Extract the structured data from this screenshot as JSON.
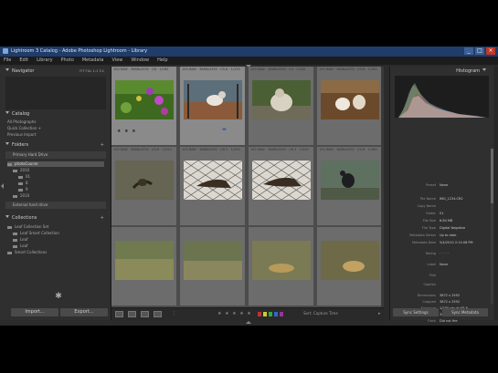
{
  "window": {
    "title": "Lightroom 3 Catalog - Adobe Photoshop Lightroom - Library",
    "controls": [
      "_",
      "□",
      "×"
    ]
  },
  "menu": [
    "File",
    "Edit",
    "Library",
    "Photo",
    "Metadata",
    "View",
    "Window",
    "Help"
  ],
  "left_panel": {
    "navigator": {
      "title": "Navigator",
      "modes": "FIT  FILL  1:1  3:1"
    },
    "catalog": {
      "title": "Catalog",
      "items": [
        {
          "label": "All Photographs",
          "count": ""
        },
        {
          "label": "Quick Collection +",
          "count": ""
        },
        {
          "label": "Previous Import",
          "count": ""
        }
      ]
    },
    "folders": {
      "title": "Folders",
      "volume": "Primary Hard Drive",
      "items": [
        {
          "label": "photoCourse",
          "count": ""
        },
        {
          "label": "2010",
          "count": ""
        },
        {
          "label": "01",
          "count": ""
        },
        {
          "label": "8",
          "count": ""
        },
        {
          "label": "9",
          "count": ""
        },
        {
          "label": "2010",
          "count": ""
        }
      ],
      "volume2": "External hard drive"
    },
    "collections": {
      "title": "Collections",
      "items": [
        {
          "label": "Leaf Collection Set"
        },
        {
          "label": "Leaf Smart Collection"
        },
        {
          "label": "Leaf"
        },
        {
          "label": "Leaf"
        },
        {
          "label": "Smart Collections"
        }
      ]
    },
    "buttons": {
      "import": "Import...",
      "export": "Export..."
    }
  },
  "grid": {
    "cells": [
      {
        "meta": "100 RAW · 3888x2592 · f/8 · 1/160",
        "stars": "★ ★ ★",
        "selected": true
      },
      {
        "meta": "100 RAW · 3888x2592 · f/5.6 · 1/125",
        "stars": "",
        "selected": true
      },
      {
        "meta": "100 RAW · 3888x2592 · f/4 · 1/200",
        "stars": "",
        "selected": false
      },
      {
        "meta": "100 RAW · 3888x2592 · f/5.6 · 1/160",
        "stars": "",
        "selected": false
      },
      {
        "meta": "100 RAW · 3888x2592 · f/5.6 · 1/250",
        "stars": "",
        "selected": false
      },
      {
        "meta": "100 RAW · 3888x2592 · f/6.3 · 1/200",
        "stars": "",
        "selected": false
      },
      {
        "meta": "100 RAW · 3888x2592 · f/6.3 · 1/200",
        "stars": "",
        "selected": false
      },
      {
        "meta": "100 RAW · 3888x2592 · f/5.6 · 1/160",
        "stars": "",
        "selected": false
      },
      {
        "meta": "",
        "stars": "",
        "selected": false
      },
      {
        "meta": "",
        "stars": "",
        "selected": false
      },
      {
        "meta": "",
        "stars": "",
        "selected": false
      },
      {
        "meta": "",
        "stars": "",
        "selected": false
      }
    ]
  },
  "toolbar": {
    "stars": "★ ★ ★ ★ ★",
    "label_colors": [
      "#b33",
      "#cc3",
      "#3a3",
      "#36c",
      "#939"
    ],
    "sort": "Sort: Capture Time"
  },
  "right_panel": {
    "histogram": {
      "title": "Histogram"
    },
    "metadata": {
      "preset_label": "Preset",
      "preset_value": "None",
      "rows": [
        {
          "label": "File Name",
          "value": "IMG_1234.CR2"
        },
        {
          "label": "Copy Name",
          "value": ""
        },
        {
          "label": "Folder",
          "value": "01"
        },
        {
          "label": "File Size",
          "value": "6.84 MB"
        },
        {
          "label": "File Type",
          "value": "Digital Negative"
        },
        {
          "label": "Metadata Status",
          "value": "Up to date"
        },
        {
          "label": "Metadata Date",
          "value": "5/4/2010 2:14:08 PM"
        },
        {
          "label": "Rating",
          "value": "· · · · ·"
        },
        {
          "label": "Label",
          "value": "None"
        },
        {
          "label": "Title",
          "value": ""
        },
        {
          "label": "Caption",
          "value": ""
        },
        {
          "label": "Dimensions",
          "value": "3872 x 2592"
        },
        {
          "label": "Cropped",
          "value": "3872 x 2592"
        },
        {
          "label": "Exposure",
          "value": "1/200 sec at f/5.6"
        },
        {
          "label": "Focal Length",
          "value": "300 mm"
        },
        {
          "label": "Flash",
          "value": "Did not fire"
        }
      ]
    },
    "buttons": {
      "sync": "Sync Settings",
      "sync_meta": "Sync Metadata"
    }
  }
}
